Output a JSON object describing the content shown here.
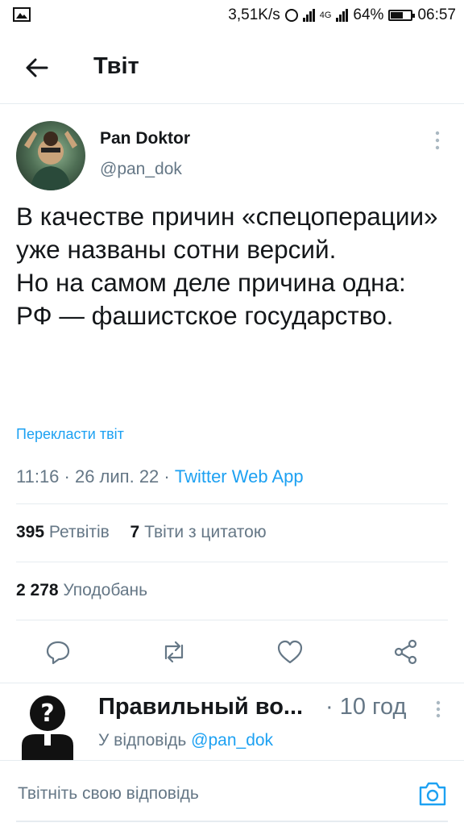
{
  "status_bar": {
    "speed": "3,51K/s",
    "network": "4G",
    "battery": "64%",
    "battery_level": 0.64,
    "time": "06:57"
  },
  "header": {
    "title": "Твіт",
    "back_icon": "arrow-left-icon"
  },
  "tweet": {
    "author": {
      "name": "Pan Doktor",
      "handle": "@pan_dok"
    },
    "text": "В качестве причин «спецоперации» уже названы сотни версий.\nНо на самом деле причина одна: РФ — фашистское государство.",
    "translate_label": "Перекласти твіт",
    "timestamp": "11:16 · 26 лип. 22 · ",
    "client": "Twitter Web App",
    "retweets": {
      "count": "395",
      "label": "Ретвітів"
    },
    "quotes": {
      "count": "7",
      "label": "Твіти з цитатою"
    },
    "likes": {
      "count": "2 278",
      "label": "Уподобань"
    }
  },
  "actions": [
    {
      "name": "reply-icon"
    },
    {
      "name": "retweet-icon"
    },
    {
      "name": "like-icon"
    },
    {
      "name": "share-icon"
    }
  ],
  "reply": {
    "author": "Правильный во...",
    "time": "· 10 год",
    "reply_prefix": "У відповідь ",
    "reply_to": "@pan_dok"
  },
  "composer": {
    "placeholder": "Твітніть свою відповідь",
    "icon": "camera-icon"
  },
  "colors": {
    "accent": "#1da1f2",
    "secondary_text": "#657786",
    "divider": "#e6ecf0"
  }
}
